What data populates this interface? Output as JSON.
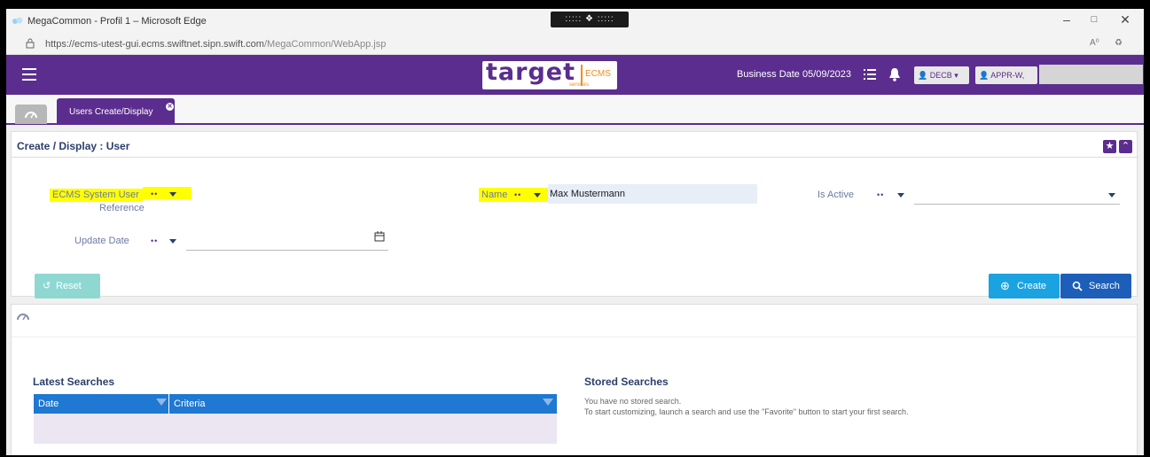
{
  "browser": {
    "window_title": "MegaCommon - Profil 1 – Microsoft Edge",
    "url_main": "https://ecms-utest-gui.ecms.swiftnet.sipn.swift.com",
    "url_path": "/MegaCommon/WebApp.jsp",
    "center_grip": "::::: ❖ :::::"
  },
  "header": {
    "brand": "target",
    "brand_suffix": "ECMS",
    "brand_sub": "services",
    "business_date": "Business Date 05/09/2023",
    "entity_button": "DECB",
    "user_button": "APPR-W,"
  },
  "tabs": {
    "active_label": "Users Create/Display"
  },
  "panel": {
    "title": "Create / Display : User",
    "fields": {
      "user_ref_label": "ECMS System User",
      "user_ref_label2": "Reference",
      "name_label": "Name",
      "name_value": "Max Mustermann",
      "active_label": "Is Active",
      "update_label": "Update Date",
      "operator": "••"
    },
    "buttons": {
      "reset": "Reset",
      "create": "Create",
      "search": "Search"
    }
  },
  "latest": {
    "title": "Latest Searches",
    "columns": [
      "Date",
      "Criteria"
    ]
  },
  "stored": {
    "title": "Stored Searches",
    "line1": "You have no stored search.",
    "line2": "To start customizing, launch a search and use the \"Favorite\" button to start your first search."
  },
  "colors": {
    "brand": "#5b2d8e",
    "accent_orange": "#f28c1f",
    "create_button": "#1aa3e0",
    "search_button": "#1d5fb8",
    "reset_button": "#8fd8d2",
    "highlight": "#ffff00"
  }
}
